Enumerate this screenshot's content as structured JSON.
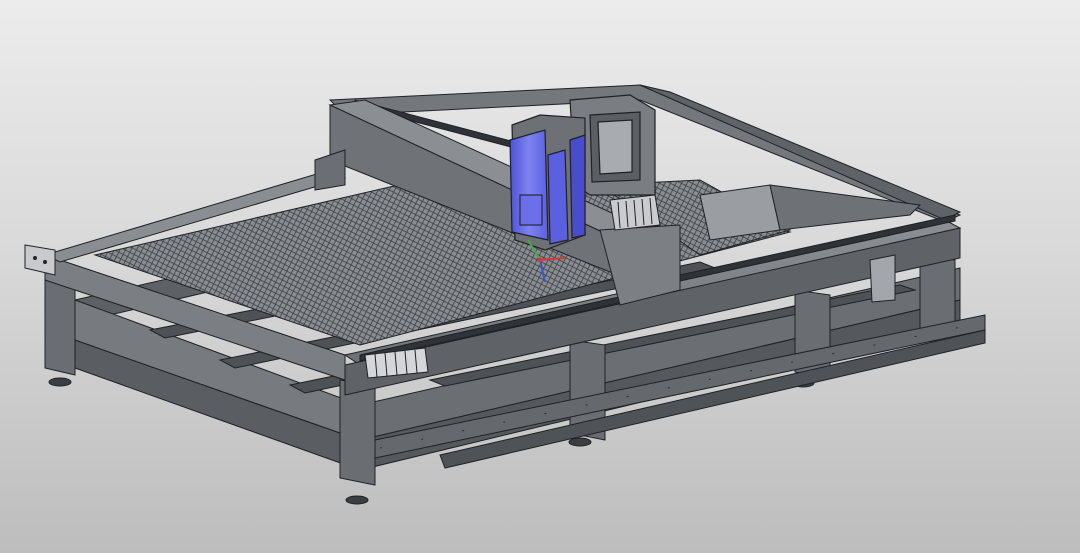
{
  "viewport": {
    "background_top": "#ececec",
    "background_bottom": "#bdbdbd"
  },
  "model": {
    "subject": "laser-cutting-machine-3d-model",
    "frame_color": "#6d7074",
    "frame_dark": "#4a4d52",
    "frame_light": "#8d9095",
    "slat_bed_color": "#7b7f84",
    "gantry_color": "#7a7d82",
    "cutting_head_color": "#6b6fe8",
    "edge_color": "#1f2124"
  },
  "triad": {
    "x_color": "#d23a3a",
    "y_color": "#3fae4a",
    "z_color": "#3a55d2"
  }
}
